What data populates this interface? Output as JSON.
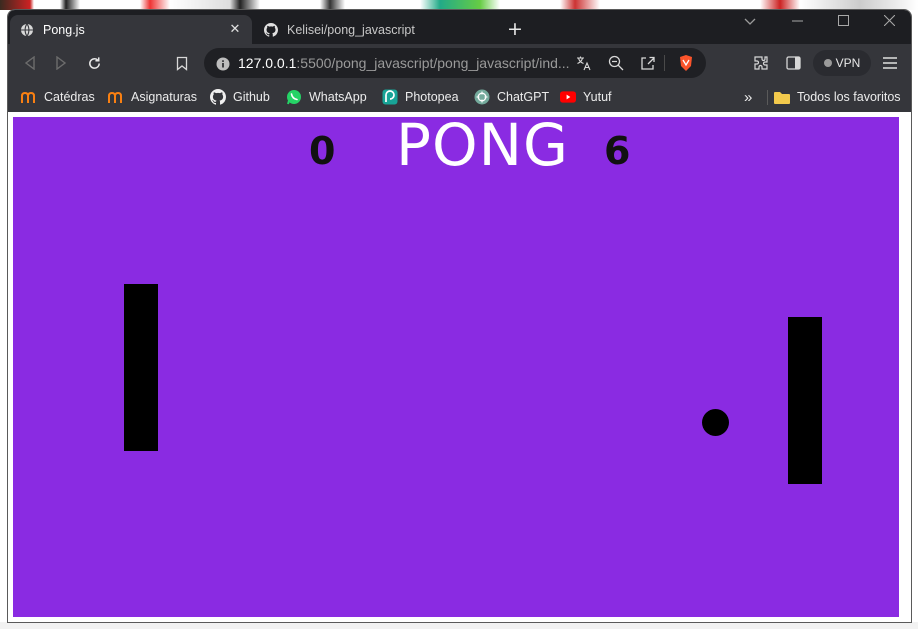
{
  "tabs": [
    {
      "title": "Pong.js",
      "active": true,
      "icon": "globe-icon"
    },
    {
      "title": "Kelisei/pong_javascript",
      "active": false,
      "icon": "github-icon"
    }
  ],
  "toolbar": {
    "url_host": "127.0.0.1",
    "url_rest": ":5500/pong_javascript/pong_javascript/ind...",
    "vpn_label": "VPN"
  },
  "bookmarks": [
    {
      "label": "Catédras",
      "icon": "moodle-icon"
    },
    {
      "label": "Asignaturas",
      "icon": "moodle-icon"
    },
    {
      "label": "Github",
      "icon": "github-icon"
    },
    {
      "label": "WhatsApp",
      "icon": "whatsapp-icon"
    },
    {
      "label": "Photopea",
      "icon": "photopea-icon"
    },
    {
      "label": "ChatGPT",
      "icon": "chatgpt-icon"
    },
    {
      "label": "Yutuf",
      "icon": "youtube-icon"
    }
  ],
  "bookmarks_overflow": "»",
  "all_bookmarks": "Todos los favoritos",
  "game": {
    "title": "PONG",
    "score_left": "0",
    "score_right": "6"
  },
  "colors": {
    "game_background": "#8a2be2",
    "paddle": "#000000",
    "title": "#ffffff"
  }
}
